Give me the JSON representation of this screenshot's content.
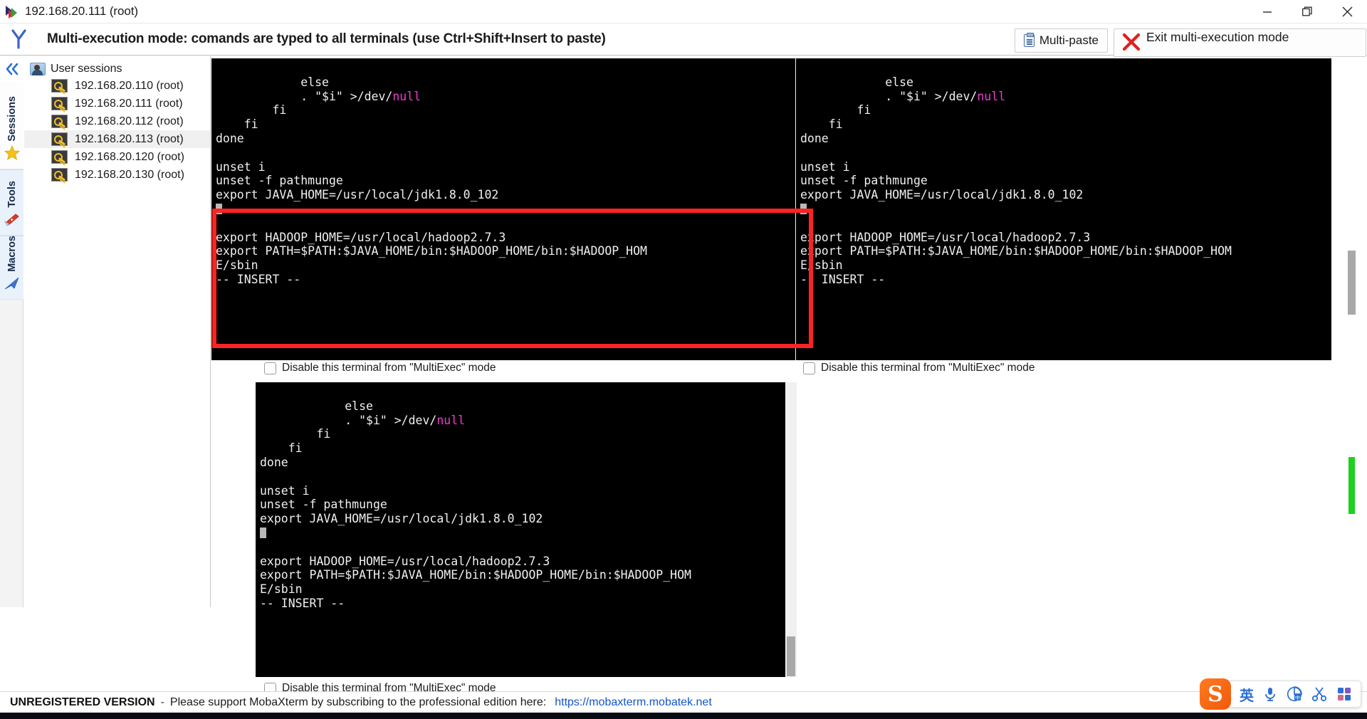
{
  "window": {
    "title": "192.168.20.111 (root)",
    "icon": "mobaxterm-logo-icon",
    "controls": {
      "minimize": "minimize-icon",
      "restore": "restore-icon",
      "close": "close-icon"
    }
  },
  "banner": {
    "icon": "multiexec-fork-icon",
    "title": "Multi-execution mode: comands are typed to all terminals (use Ctrl+Shift+Insert to paste)",
    "multi_paste_label": "Multi-paste",
    "exit_label": "Exit multi-execution mode"
  },
  "vertical_tabs": {
    "collapse_icon": "double-chevron-left-icon",
    "items": [
      {
        "label": "Sessions",
        "icon": "star-icon",
        "active": true
      },
      {
        "label": "Tools",
        "icon": "swiss-knife-icon",
        "active": false
      },
      {
        "label": "Macros",
        "icon": "blue-arrow-icon",
        "active": false
      }
    ]
  },
  "sidebar": {
    "root_label": "User sessions",
    "root_icon": "user-folder-icon",
    "sessions": [
      {
        "label": "192.168.20.110 (root)",
        "icon": "ssh-key-icon",
        "selected": false
      },
      {
        "label": "192.168.20.111 (root)",
        "icon": "ssh-key-icon",
        "selected": false
      },
      {
        "label": "192.168.20.112 (root)",
        "icon": "ssh-key-icon",
        "selected": false
      },
      {
        "label": "192.168.20.113 (root)",
        "icon": "ssh-key-icon",
        "selected": true
      },
      {
        "label": "192.168.20.120 (root)",
        "icon": "ssh-key-icon",
        "selected": false
      },
      {
        "label": "192.168.20.130 (root)",
        "icon": "ssh-key-icon",
        "selected": false
      }
    ]
  },
  "terminals": {
    "disable_checkbox_label": "Disable this terminal from \"MultiExec\" mode",
    "content_lines_a": "        else\n            . \"$i\" >/dev/null\n        fi\n    fi\ndone\n\nunset i\nunset -f pathmunge\n",
    "content_lines_b": "export JAVA_HOME=/usr/local/jdk1.8.0_102\n",
    "content_lines_c": "\n\nexport HADOOP_HOME=/usr/local/hadoop2.7.3\nexport PATH=$PATH:$JAVA_HOME/bin:$HADOOP_HOME/bin:$HADOOP_HOM\nE/sbin\n-- INSERT --",
    "null_token": "null",
    "panes": [
      {
        "name": "terminal-top-left",
        "checkbox_checked": false
      },
      {
        "name": "terminal-top-right",
        "checkbox_checked": false
      },
      {
        "name": "terminal-bottom-left",
        "checkbox_checked": false
      }
    ]
  },
  "highlight": {
    "color": "#fb2323"
  },
  "statusbar": {
    "unregistered": "UNREGISTERED VERSION",
    "dash": "-",
    "message": "Please support MobaXterm by subscribing to the professional edition here:",
    "link": "https://mobaxterm.mobatek.net"
  },
  "ime": {
    "logo": "sogou-logo-icon",
    "logo_letter": "S",
    "items": [
      {
        "label": "英",
        "name": "language-mode-icon"
      },
      {
        "label": "",
        "name": "microphone-icon"
      },
      {
        "label": "",
        "name": "translate-icon"
      },
      {
        "label": "",
        "name": "scissors-icon"
      },
      {
        "label": "",
        "name": "apps-grid-icon"
      }
    ]
  }
}
